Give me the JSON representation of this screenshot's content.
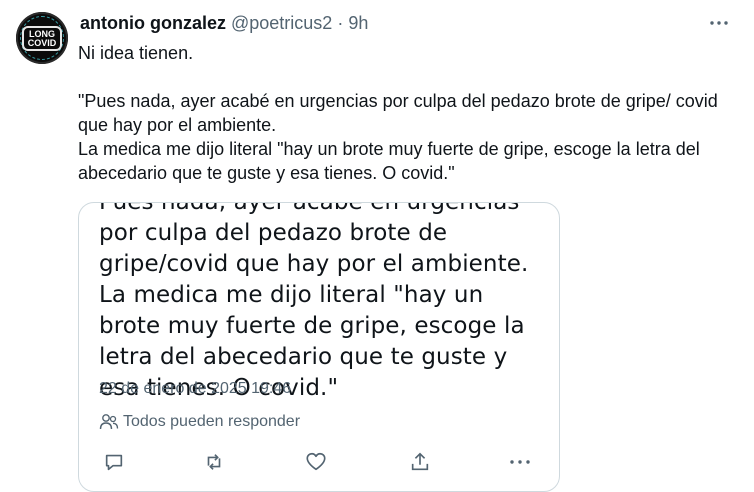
{
  "author": {
    "name": "antonio gonzalez",
    "handle": "@poetricus2",
    "separator": "·",
    "time": "9h",
    "avatar_text_line1": "LONG",
    "avatar_text_line2": "COVID"
  },
  "tweet": {
    "line1": "Ni idea tienen.",
    "paragraph": "\"Pues nada, ayer acabé en urgencias por culpa del pedazo brote de gripe/ covid que hay por el ambiente.",
    "paragraph2": "La medica me dijo literal \"hay un brote muy fuerte de gripe, escoge la letra del abecedario que te guste y esa tienes. O covid.\""
  },
  "embedded": {
    "text": "Pues nada, ayer acabé en urgencias por culpa del pedazo brote de gripe/covid que hay por el ambiente. La medica me dijo literal \"hay un brote muy fuerte de gripe, escoge la letra del abecedario que te guste y esa tienes. O covid.\"",
    "date": "22 de enero de 2025 19:46",
    "reply_setting": "Todos pueden responder",
    "actions": [
      "reply-icon",
      "repost-icon",
      "like-icon",
      "share-icon",
      "more-icon"
    ]
  },
  "more_menu_icon": "more-horizontal-icon",
  "colors": {
    "text": "#0f1419",
    "secondary": "#536471",
    "border": "#cfd9de"
  }
}
